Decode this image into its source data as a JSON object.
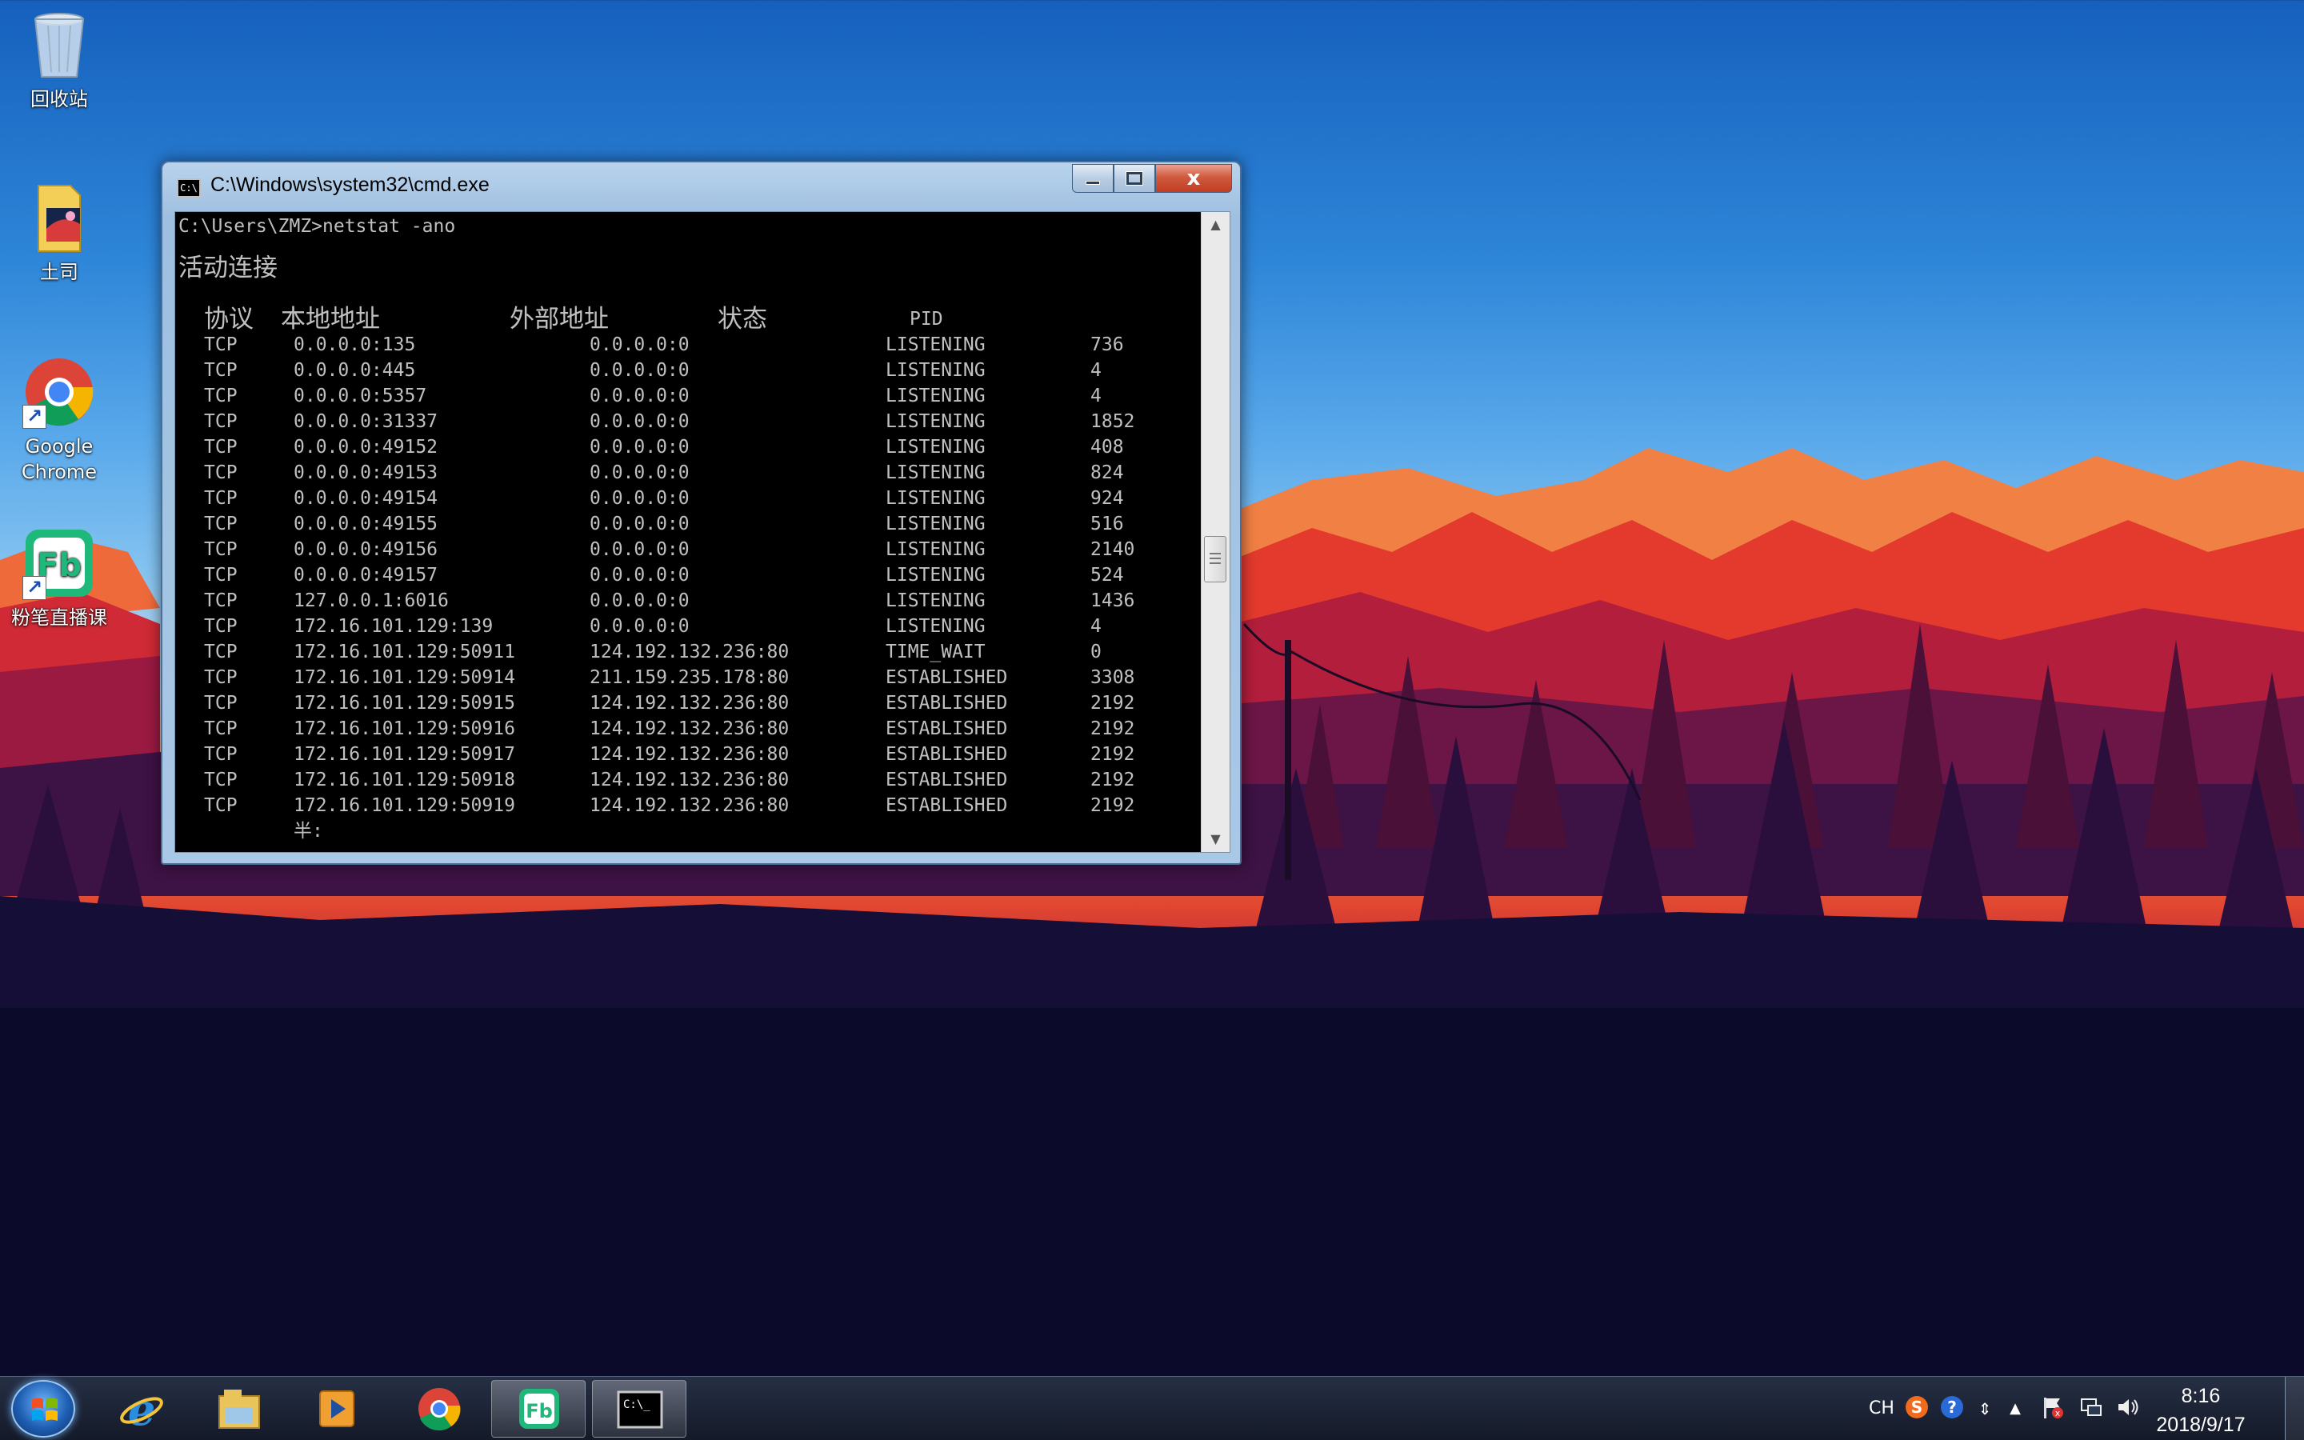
{
  "desktop": {
    "icons": [
      {
        "label": "回收站",
        "icon": "recycle-bin-icon"
      },
      {
        "label": "土司",
        "icon": "folder-icon"
      },
      {
        "label": "Google Chrome",
        "icon": "chrome-icon"
      },
      {
        "label": "粉笔直播课",
        "icon": "fenbi-icon"
      }
    ]
  },
  "cmd": {
    "title": "C:\\Windows\\system32\\cmd.exe",
    "caption_close": "x",
    "prompt_line": "C:\\Users\\ZMZ>netstat -ano",
    "section_title": "活动连接",
    "headers": {
      "proto": "协议",
      "local": "本地地址",
      "foreign": "外部地址",
      "state": "状态",
      "pid": "PID"
    },
    "rows": [
      {
        "proto": "TCP",
        "local": "0.0.0.0:135",
        "foreign": "0.0.0.0:0",
        "state": "LISTENING",
        "pid": "736"
      },
      {
        "proto": "TCP",
        "local": "0.0.0.0:445",
        "foreign": "0.0.0.0:0",
        "state": "LISTENING",
        "pid": "4"
      },
      {
        "proto": "TCP",
        "local": "0.0.0.0:5357",
        "foreign": "0.0.0.0:0",
        "state": "LISTENING",
        "pid": "4"
      },
      {
        "proto": "TCP",
        "local": "0.0.0.0:31337",
        "foreign": "0.0.0.0:0",
        "state": "LISTENING",
        "pid": "1852"
      },
      {
        "proto": "TCP",
        "local": "0.0.0.0:49152",
        "foreign": "0.0.0.0:0",
        "state": "LISTENING",
        "pid": "408"
      },
      {
        "proto": "TCP",
        "local": "0.0.0.0:49153",
        "foreign": "0.0.0.0:0",
        "state": "LISTENING",
        "pid": "824"
      },
      {
        "proto": "TCP",
        "local": "0.0.0.0:49154",
        "foreign": "0.0.0.0:0",
        "state": "LISTENING",
        "pid": "924"
      },
      {
        "proto": "TCP",
        "local": "0.0.0.0:49155",
        "foreign": "0.0.0.0:0",
        "state": "LISTENING",
        "pid": "516"
      },
      {
        "proto": "TCP",
        "local": "0.0.0.0:49156",
        "foreign": "0.0.0.0:0",
        "state": "LISTENING",
        "pid": "2140"
      },
      {
        "proto": "TCP",
        "local": "0.0.0.0:49157",
        "foreign": "0.0.0.0:0",
        "state": "LISTENING",
        "pid": "524"
      },
      {
        "proto": "TCP",
        "local": "127.0.0.1:6016",
        "foreign": "0.0.0.0:0",
        "state": "LISTENING",
        "pid": "1436"
      },
      {
        "proto": "TCP",
        "local": "172.16.101.129:139",
        "foreign": "0.0.0.0:0",
        "state": "LISTENING",
        "pid": "4"
      },
      {
        "proto": "TCP",
        "local": "172.16.101.129:50911",
        "foreign": "124.192.132.236:80",
        "state": "TIME_WAIT",
        "pid": "0"
      },
      {
        "proto": "TCP",
        "local": "172.16.101.129:50914",
        "foreign": "211.159.235.178:80",
        "state": "ESTABLISHED",
        "pid": "3308"
      },
      {
        "proto": "TCP",
        "local": "172.16.101.129:50915",
        "foreign": "124.192.132.236:80",
        "state": "ESTABLISHED",
        "pid": "2192"
      },
      {
        "proto": "TCP",
        "local": "172.16.101.129:50916",
        "foreign": "124.192.132.236:80",
        "state": "ESTABLISHED",
        "pid": "2192"
      },
      {
        "proto": "TCP",
        "local": "172.16.101.129:50917",
        "foreign": "124.192.132.236:80",
        "state": "ESTABLISHED",
        "pid": "2192"
      },
      {
        "proto": "TCP",
        "local": "172.16.101.129:50918",
        "foreign": "124.192.132.236:80",
        "state": "ESTABLISHED",
        "pid": "2192"
      },
      {
        "proto": "TCP",
        "local": "172.16.101.129:50919",
        "foreign": "124.192.132.236:80",
        "state": "ESTABLISHED",
        "pid": "2192"
      }
    ],
    "ime_indicator": "半:",
    "scroll_position": 0.55
  },
  "taskbar": {
    "buttons": [
      {
        "icon": "ie-icon",
        "active": false
      },
      {
        "icon": "file-explorer-icon",
        "active": false
      },
      {
        "icon": "media-player-icon",
        "active": false
      },
      {
        "icon": "chrome-icon",
        "active": false
      },
      {
        "icon": "fenbi-icon",
        "active": true
      },
      {
        "icon": "cmd-icon",
        "active": true
      }
    ],
    "tray": {
      "language": "CH",
      "time": "8:16",
      "date": "2018/9/17"
    }
  },
  "colors": {
    "console_bg": "#000000",
    "console_fg": "#c0c0c0",
    "close_button": "#c13d22"
  }
}
